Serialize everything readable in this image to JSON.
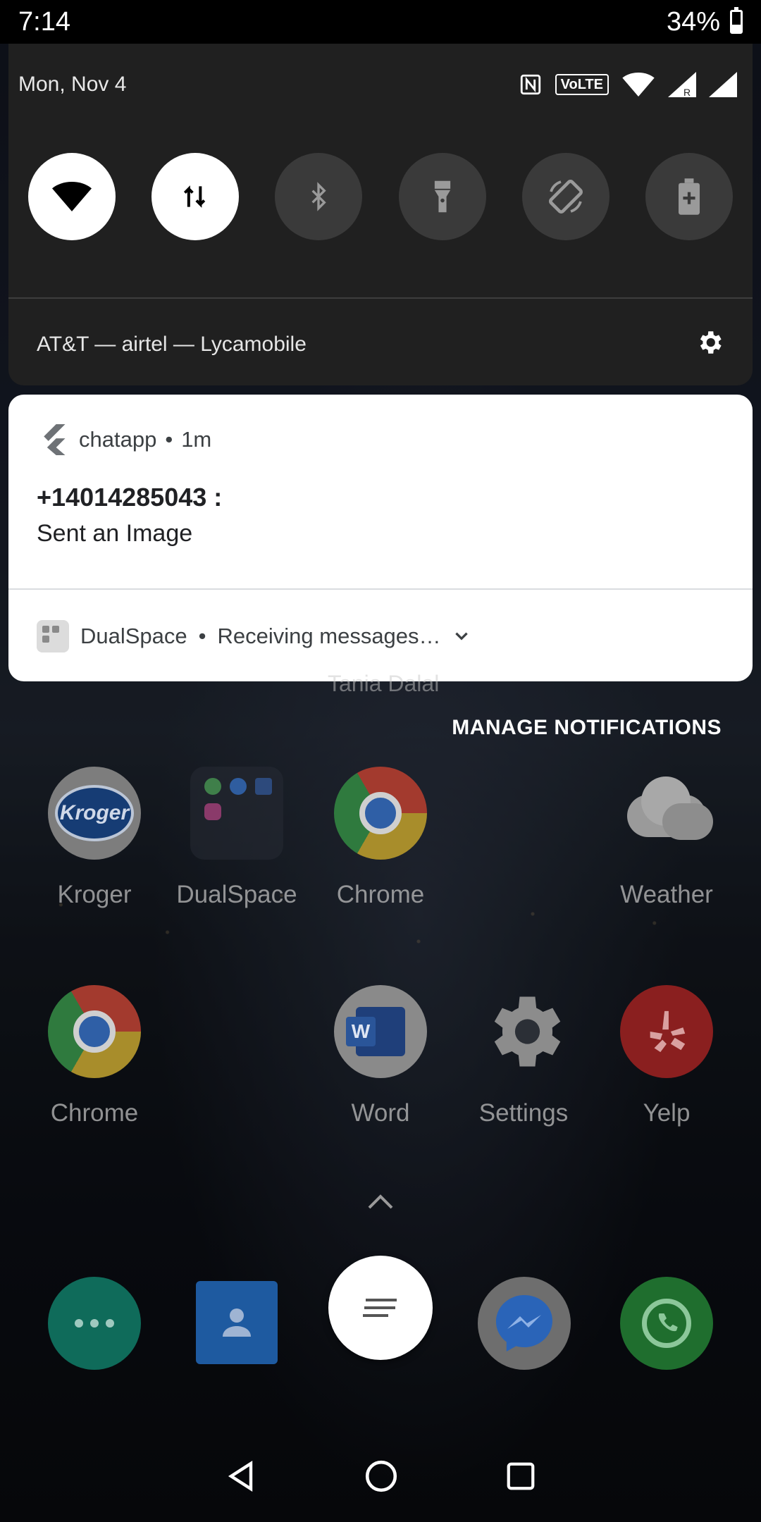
{
  "status_bar": {
    "time": "7:14",
    "battery": "34%",
    "battery_level": 0.34
  },
  "quick_settings": {
    "date": "Mon, Nov 4",
    "indicators": [
      "nfc-icon",
      "VoLTE",
      "wifi-icon",
      "signal-roaming-icon",
      "signal-icon"
    ],
    "volte_label": "VoLTE",
    "tiles": [
      {
        "name": "wifi",
        "on": true
      },
      {
        "name": "mobile-data",
        "on": true
      },
      {
        "name": "bluetooth",
        "on": false
      },
      {
        "name": "flashlight",
        "on": false
      },
      {
        "name": "auto-rotate",
        "on": false
      },
      {
        "name": "battery-saver",
        "on": false
      }
    ],
    "carrier": "AT&T — airtel — Lycamobile"
  },
  "notification": {
    "app_name": "chatapp",
    "separator": "•",
    "time": "1m",
    "title": "+14014285043 :",
    "text": "Sent an Image"
  },
  "dualspace": {
    "app_name": "DualSpace",
    "separator": "•",
    "text": "Receiving messages…"
  },
  "manage_notifications": "MANAGE NOTIFICATIONS",
  "home": {
    "partial_text": "Tania Dalal",
    "row1": [
      {
        "label": "Kroger",
        "icon": "kroger-icon"
      },
      {
        "label": "DualSpace",
        "icon": "dualspace-folder-icon"
      },
      {
        "label": "Chrome",
        "icon": "chrome-icon"
      },
      {
        "label": "Weather",
        "icon": "weather-icon"
      }
    ],
    "row2": [
      {
        "label": "Chrome",
        "icon": "chrome-icon"
      },
      {
        "label": "Word",
        "icon": "word-icon"
      },
      {
        "label": "Settings",
        "icon": "settings-icon"
      },
      {
        "label": "Yelp",
        "icon": "yelp-icon"
      }
    ],
    "kroger_text": "Kroger",
    "word_letter": "W",
    "dock": [
      "hangouts-icon",
      "contacts-icon",
      "messages-icon",
      "messenger-icon",
      "whatsapp-icon"
    ]
  },
  "colors": {
    "panel": "#202020",
    "tile_off": "#3a3a3a",
    "tile_on": "#ffffff",
    "card": "#ffffff"
  }
}
